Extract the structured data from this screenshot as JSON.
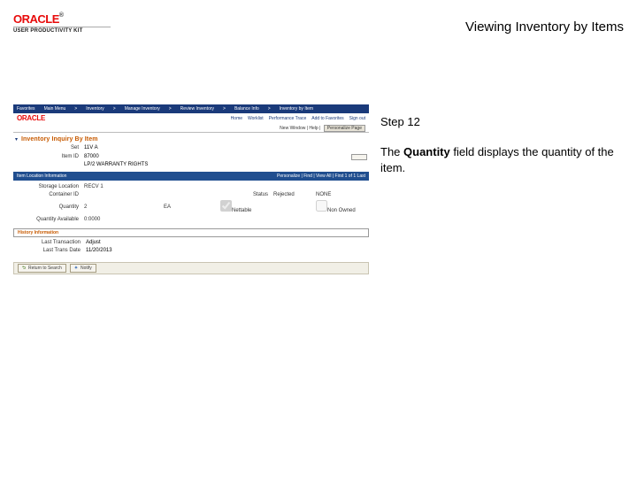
{
  "header": {
    "logo_text": "ORACLE",
    "logo_tm": "®",
    "upk_label": "USER PRODUCTIVITY KIT",
    "page_title": "Viewing Inventory by Items"
  },
  "instruction": {
    "step_label": "Step 12",
    "desc_pre": "The ",
    "desc_bold": "Quantity",
    "desc_post": " field displays the quantity of the item."
  },
  "shot": {
    "nav": [
      "Favorites",
      "Main Menu",
      "Inventory",
      "Manage Inventory",
      "Review Inventory",
      "Balance Info",
      "Inventory by Item"
    ],
    "logo2": "ORACLE",
    "midlinks": [
      "Home",
      "Worklist",
      "Performance Trace",
      "Add to Favorites",
      "Sign out"
    ],
    "subbar_left": "New Window | Help |",
    "subbar_btn": "Personalize Page",
    "panel_title": "Inventory Inquiry By Item",
    "set": {
      "lbl": "Set",
      "val": "11V  A"
    },
    "itemid": {
      "lbl": "Item ID",
      "val": "87000"
    },
    "desc": {
      "lbl": "",
      "val": "LP/2 WARRANTY RIGHTS"
    },
    "items_bar_left": "Item Location Information",
    "items_bar_right": "Personalize | Find | View All | First  1 of 1  Last",
    "storage_loc": {
      "lbl": "Storage Location",
      "val": "RECV  1"
    },
    "container": {
      "lbl": "Container ID",
      "val": ""
    },
    "status": {
      "lbl": "Status",
      "val": "Rejected",
      "extra": "NONE"
    },
    "quantity": {
      "lbl": "Quantity",
      "val": "2",
      "uom_lbl": "",
      "uom": "EA",
      "cb1": "Nettable",
      "cb2": "Non Owned"
    },
    "qty_avail": {
      "lbl": "Quantity Available",
      "val": "0:0000"
    },
    "hist_band": "History Information",
    "hist1": {
      "lbl": "Last Transaction",
      "val": "Adjust"
    },
    "hist2": {
      "lbl": "Last Trans Date",
      "val": "11/20/2013"
    },
    "btn_return": "Return to Search",
    "btn_notify": "Notify"
  }
}
